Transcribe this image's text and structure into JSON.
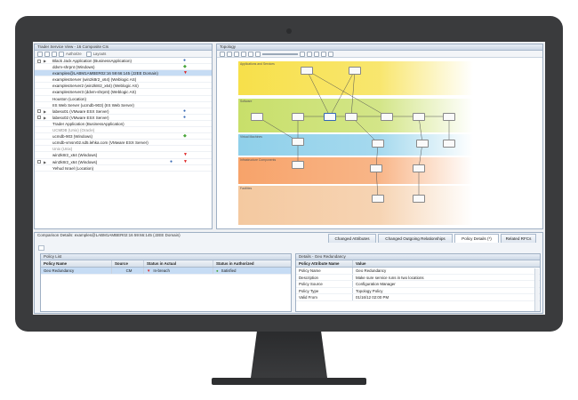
{
  "left_panel": {
    "title": "Trader Service View - 16 Composite CIs",
    "toolbar": {
      "authorize": "Authorize",
      "layout": "Layouts"
    },
    "rows": [
      {
        "label": "Black Jack Application (BusinessApplication)",
        "status": "info",
        "checkbox": true,
        "expander": true
      },
      {
        "label": "ddvm-shrpnt (Windows)",
        "status": "ok"
      },
      {
        "label": "examples@LABM1AMBER02:16 59:66:145 (J2EE Domain)",
        "status": "err",
        "selected": true
      },
      {
        "label": "examplesServer (win2k8r2_x64) (Weblogic AS)"
      },
      {
        "label": "examplesServer2 (win2k8r2_x64) (Weblogic AS)"
      },
      {
        "label": "examplesServer3 (ddvm-shrpnt) (Weblogic AS)"
      },
      {
        "label": "Houston (Location)"
      },
      {
        "label": "IIS Web Server (ucmdb-903) (IIS Web Server)"
      },
      {
        "label": "labesx01 (VMware ESX Server)",
        "status": "info",
        "checkbox": true,
        "expander": true
      },
      {
        "label": "labesx02 (VMware ESX Server)",
        "status": "info",
        "checkbox": true,
        "expander": true
      },
      {
        "label": "Trader Application (BusinessApplication)"
      },
      {
        "label": "UCMDB (Unix) (Oracle)",
        "gray": true
      },
      {
        "label": "ucmdb-903 (Windows)",
        "status": "ok"
      },
      {
        "label": "ucmdb-vmsrv02.sd5.lehka.com (VMware ESX Server)"
      },
      {
        "label": "Unix (Unix)",
        "gray": true
      },
      {
        "label": "win2k8r2_x64 (Windows)",
        "status": "err"
      },
      {
        "label": "win2k8r2_x64 (Windows)",
        "status": "info",
        "status2": "err",
        "checkbox": true,
        "expander": true
      },
      {
        "label": "Yehud Israel (Location)"
      }
    ]
  },
  "topology": {
    "title": "Topology",
    "layers": [
      {
        "label": "Applications and Services",
        "color": "#f7e04a"
      },
      {
        "label": "Software",
        "color": "#c8df6a"
      },
      {
        "label": "Virtual Machines",
        "color": "#8fd0ea"
      },
      {
        "label": "Infrastructure Components",
        "color": "#f7a36a"
      },
      {
        "label": "Facilities",
        "color": "#f4c9a0"
      }
    ]
  },
  "comparison": {
    "title": "Comparison Details: examples@LABM1AMBER02:16 59:66:145 (J2EE Domain)",
    "tabs": [
      "Changed Attributes",
      "Changed Outgoing Relationships",
      "Policy Details (*)",
      "Related RFCs"
    ],
    "active_tab": 2
  },
  "policy_list": {
    "title": "Policy List",
    "columns": [
      "Policy Name",
      "Source",
      "Status in Actual",
      "Status in Authorized"
    ],
    "rows": [
      {
        "name": "Geo Redundancy",
        "source": "CM",
        "actual": "In-breach",
        "authorized": "Satisfied"
      }
    ]
  },
  "details": {
    "title": "Details - Geo Redundancy",
    "columns": [
      "Policy Attribute Name",
      "Value"
    ],
    "rows": [
      {
        "name": "Policy Name",
        "value": "Geo Redundancy"
      },
      {
        "name": "Description",
        "value": "Make sure service runs in two locations"
      },
      {
        "name": "Policy Source",
        "value": "Configuration Manager"
      },
      {
        "name": "Policy Type",
        "value": "Topology Policy"
      },
      {
        "name": "Valid From",
        "value": "01/16/12 02:00 PM"
      }
    ]
  },
  "colors": {
    "accent": "#3567b3",
    "selection": "#c6dcf4",
    "ok": "#4aa63a",
    "error": "#dd2222"
  }
}
